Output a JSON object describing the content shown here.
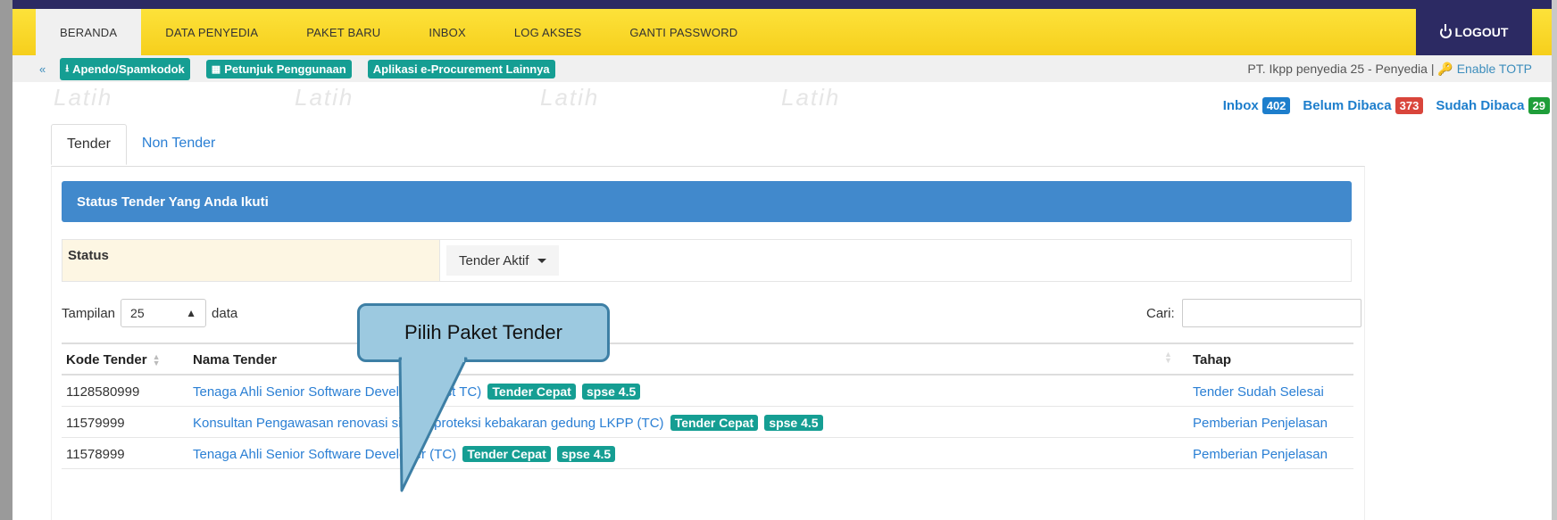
{
  "nav": {
    "items": [
      "BERANDA",
      "DATA PENYEDIA",
      "PAKET BARU",
      "INBOX",
      "LOG AKSES",
      "GANTI PASSWORD"
    ],
    "logout": "LOGOUT"
  },
  "subbar": {
    "links": [
      "Apendo/Spamkodok",
      "Petunjuk Penggunaan",
      "Aplikasi e-Procurement Lainnya"
    ],
    "user": "PT. Ikpp penyedia 25 - Penyedia |",
    "totp": "Enable TOTP"
  },
  "watermark": "Latih",
  "inbox": {
    "inbox_label": "Inbox",
    "inbox_count": "402",
    "unread_label": "Belum Dibaca",
    "unread_count": "373",
    "read_label": "Sudah Dibaca",
    "read_count": "29"
  },
  "tabs": [
    "Tender",
    "Non Tender"
  ],
  "panel": {
    "title": "Status Tender Yang Anda Ikuti",
    "status_label": "Status",
    "status_value": "Tender Aktif",
    "show_label": "Tampilan",
    "page_length": "25",
    "data_label": "data",
    "search_label": "Cari:"
  },
  "table": {
    "headers": [
      "Kode Tender",
      "Nama Tender",
      "Tahap"
    ],
    "rows": [
      {
        "kode": "1128580999",
        "nama": "Tenaga Ahli Senior Software Developer (test TC)",
        "tag1": "Tender Cepat",
        "tag2": "spse 4.5",
        "tahap": "Tender Sudah Selesai"
      },
      {
        "kode": "11579999",
        "nama": "Konsultan Pengawasan renovasi sistem proteksi kebakaran gedung LKPP (TC)",
        "tag1": "Tender Cepat",
        "tag2": "spse 4.5",
        "tahap": "Pemberian Penjelasan"
      },
      {
        "kode": "11578999",
        "nama": "Tenaga Ahli Senior Software Developer (TC)",
        "tag1": "Tender Cepat",
        "tag2": "spse 4.5",
        "tahap": "Pemberian Penjelasan"
      }
    ]
  },
  "callout": "Pilih Paket Tender"
}
